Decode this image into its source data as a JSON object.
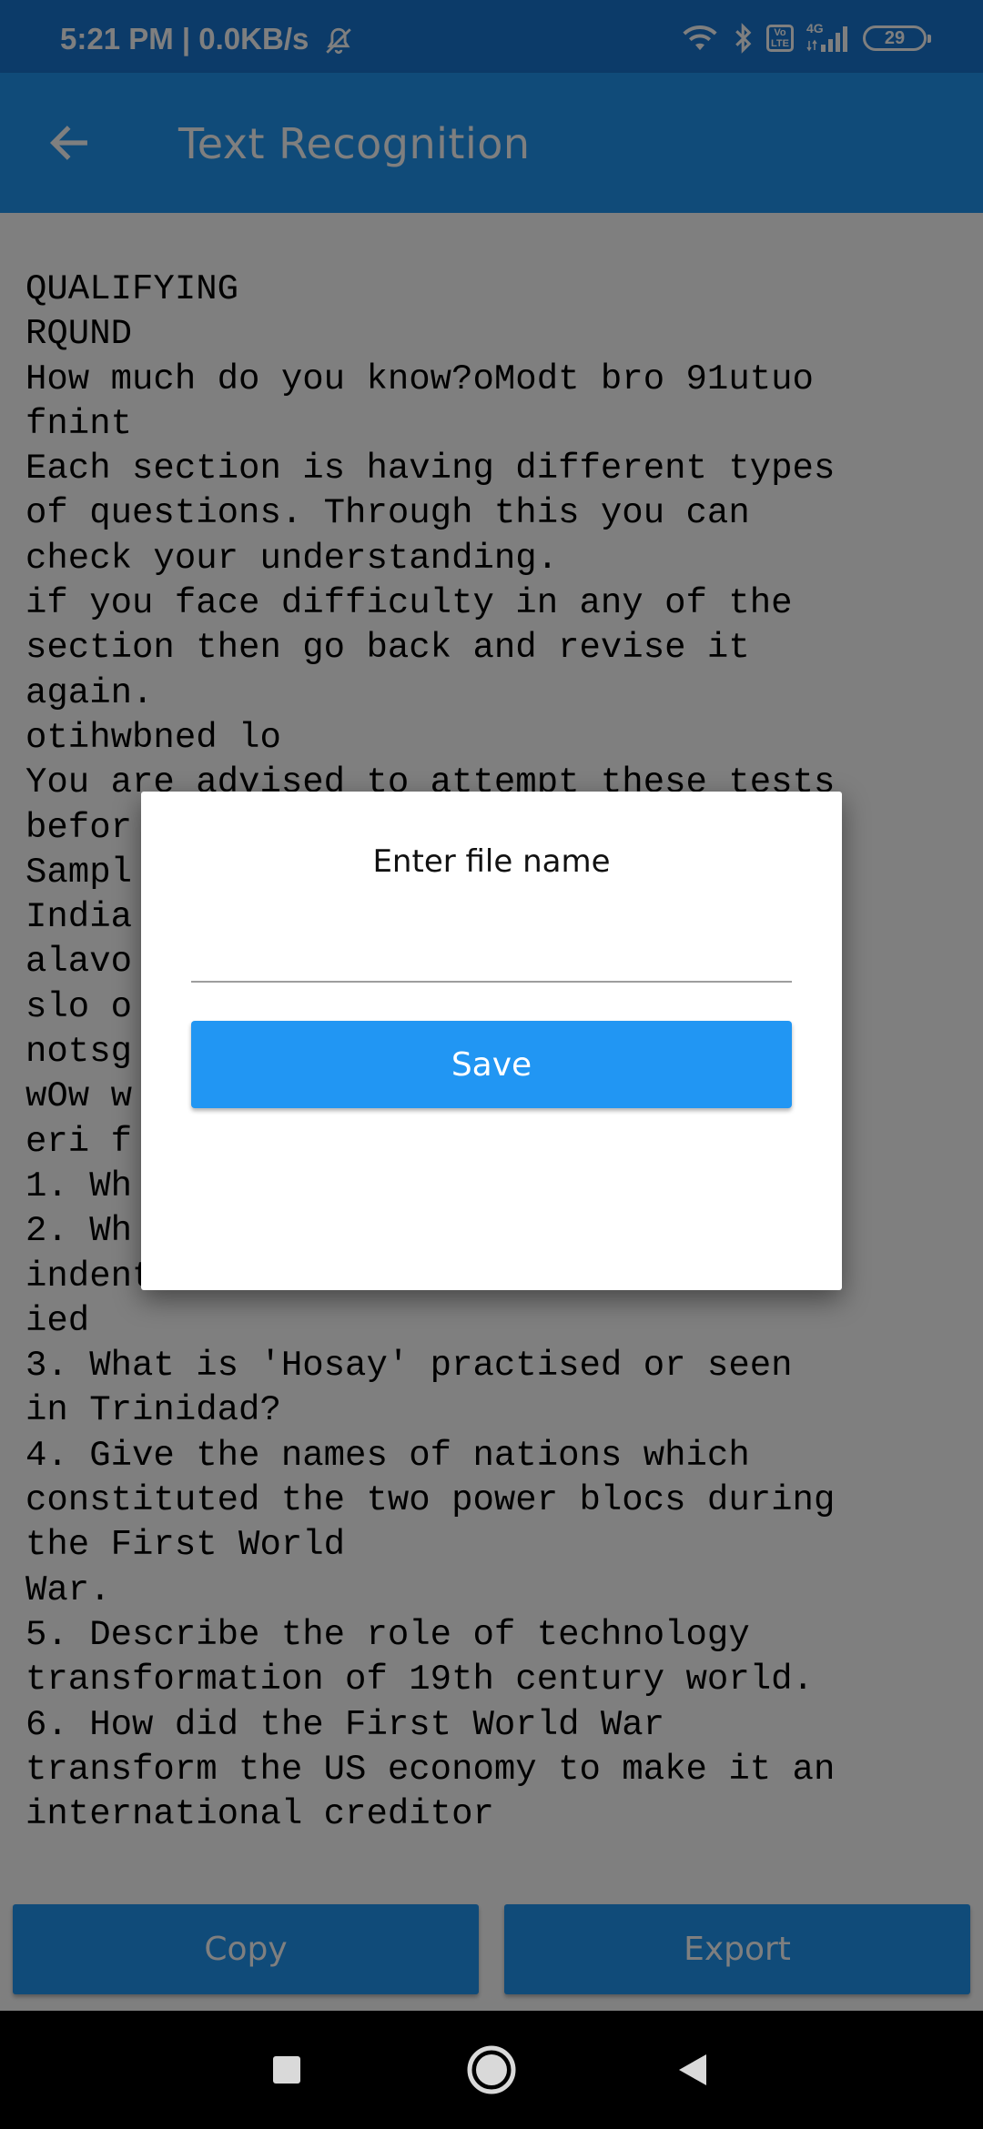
{
  "status_bar": {
    "time": "5:21 PM | 0.0KB/s",
    "network_type": "4G",
    "volte_top": "Vo",
    "volte_bottom": "LTE",
    "battery": "29",
    "icons": [
      "mute-icon",
      "wifi-icon",
      "bluetooth-icon",
      "volte-icon",
      "signal-icon",
      "battery-icon"
    ]
  },
  "app_bar": {
    "title": "Text Recognition",
    "back_icon": "arrow-left-icon"
  },
  "recognized_text": "QUALIFYING\nRQUND\nHow much do you know?oModt bro 91utuo\nfnint\nEach section is having different types\nof questions. Through this you can\ncheck your understanding.\nif you face difficulty in any of the\nsection then go back and revise it\nagain.\notihwbned lo\nYou are advised to attempt these tests\nbefor\nSampl\nIndia                               2\nalavo\nslo o\nnotsg\nwOw w\neri f\n1. Wh\n2. Wh\nindentified mutual direction of sow\nied\n3. What is 'Hosay' practised or seen\nin Trinidad?\n4. Give the names of nations which\nconstituted the two power blocs during\nthe First World\nWar.\n5. Describe the role of technology\ntransformation of 19th century world.\n6. How did the First World War\ntransform the US economy to make it an\ninternational creditor",
  "actions": {
    "copy_label": "Copy",
    "export_label": "Export"
  },
  "dialog": {
    "title": "Enter file name",
    "filename_value": "",
    "save_label": "Save"
  },
  "nav_bar": {
    "icons": [
      "recents-square-icon",
      "home-circle-icon",
      "back-triangle-icon"
    ]
  },
  "colors": {
    "primary": "#2196f3",
    "primary_dark": "#1976d2",
    "scrim": "rgba(0,0,0,0.5)"
  }
}
